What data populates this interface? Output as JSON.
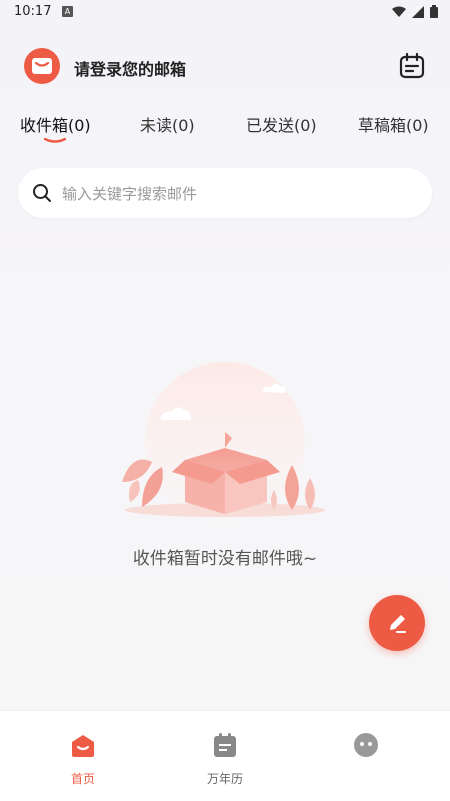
{
  "status_bar": {
    "time": "10:17",
    "notification_icon": "A"
  },
  "header": {
    "title": "请登录您的邮箱"
  },
  "tabs": [
    {
      "label": "收件箱(0)",
      "active": true
    },
    {
      "label": "未读(0)",
      "active": false
    },
    {
      "label": "已发送(0)",
      "active": false
    },
    {
      "label": "草稿箱(0)",
      "active": false
    }
  ],
  "search": {
    "placeholder": "输入关键字搜索邮件"
  },
  "empty_state": {
    "message": "收件箱暂时没有邮件哦~"
  },
  "bottom_nav": [
    {
      "label": "首页",
      "icon": "home-icon",
      "active": true
    },
    {
      "label": "万年历",
      "icon": "calendar-icon",
      "active": false
    }
  ],
  "colors": {
    "accent": "#ee5b45",
    "background": "#f6f5f8"
  }
}
